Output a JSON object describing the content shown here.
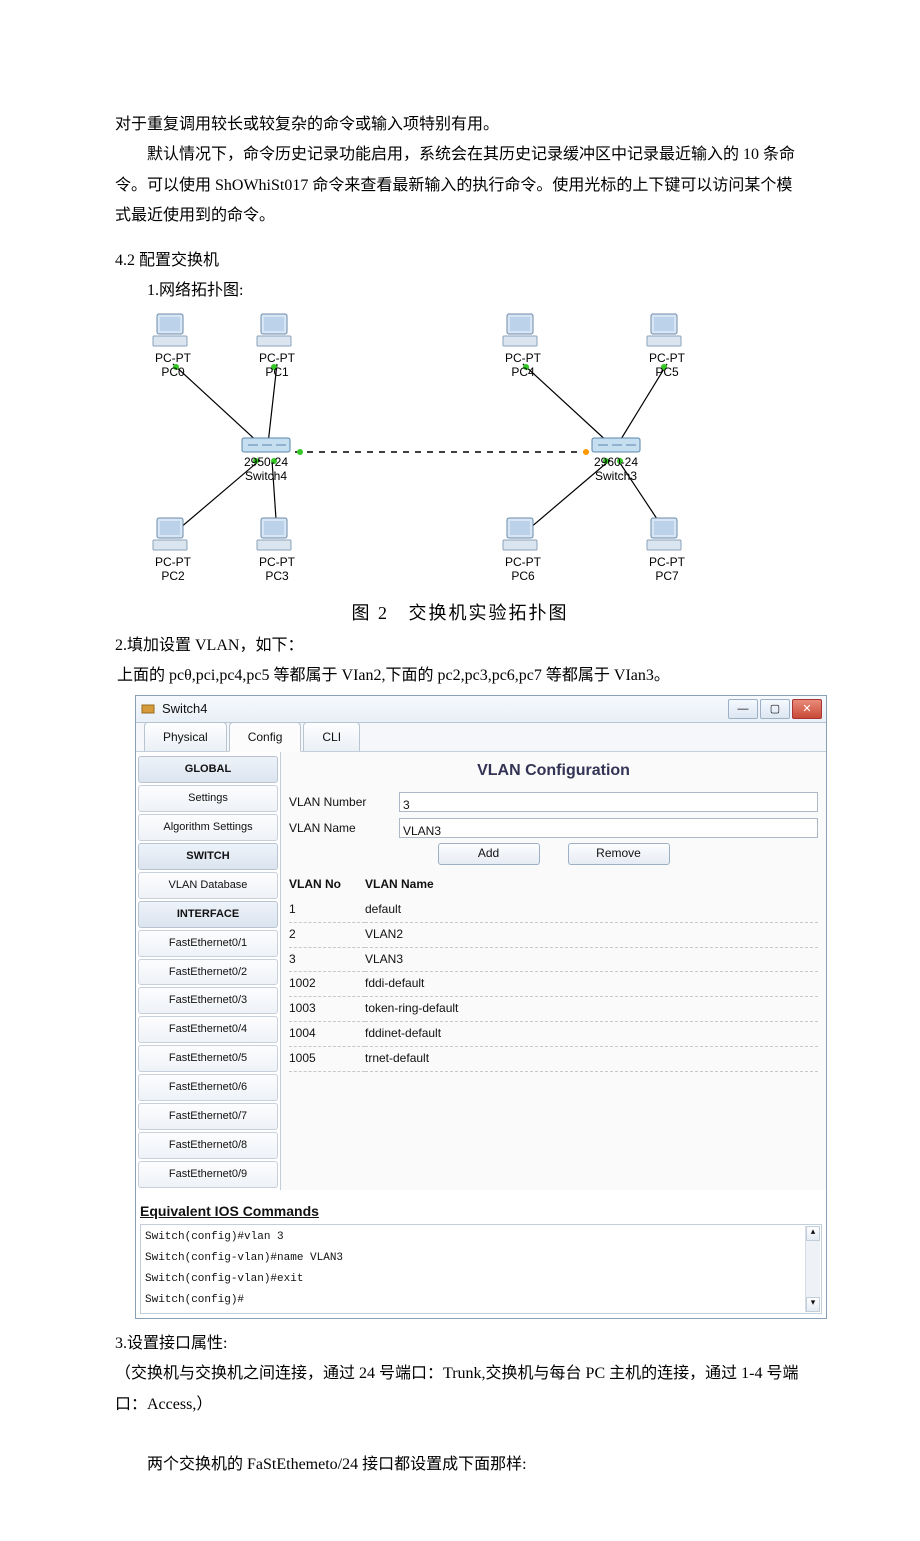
{
  "intro": {
    "p1": "对于重复调用较长或较复杂的命令或输入项特别有用。",
    "p2": "默认情况下，命令历史记录功能启用，系统会在其历史记录缓冲区中记录最近输入的 10 条命令。可以使用 ShOWhiSt017 命令来查看最新输入的执行命令。使用光标的上下键可以访问某个模式最近使用到的命令。"
  },
  "sec42": {
    "title": "4.2    配置交换机",
    "item1": "1.网络拓扑图:"
  },
  "topology": {
    "caption_label": "图 2",
    "caption_text": "交换机实验拓扑图",
    "devices": {
      "pc0": {
        "type": "PC-PT",
        "name": "PC0"
      },
      "pc1": {
        "type": "PC-PT",
        "name": "PC1"
      },
      "pc2": {
        "type": "PC-PT",
        "name": "PC2"
      },
      "pc3": {
        "type": "PC-PT",
        "name": "PC3"
      },
      "pc4": {
        "type": "PC-PT",
        "name": "PC4"
      },
      "pc5": {
        "type": "PC-PT",
        "name": "PC5"
      },
      "pc6": {
        "type": "PC-PT",
        "name": "PC6"
      },
      "pc7": {
        "type": "PC-PT",
        "name": "PC7"
      },
      "sw_left": {
        "type": "2950-24",
        "name": "Switch4"
      },
      "sw_right": {
        "type": "2960-24",
        "name": "Switch3"
      }
    }
  },
  "item2": {
    "title": "2.填加设置 VLAN，如下：",
    "desc": "上面的 pcθ,pci,pc4,pc5 等都属于 VIan2,下面的 pc2,pc3,pc6,pc7 等都属于 VIan3。"
  },
  "window": {
    "title": "Switch4",
    "tabs": {
      "physical": "Physical",
      "config": "Config",
      "cli": "CLI"
    },
    "sidebar": {
      "global": "GLOBAL",
      "settings": "Settings",
      "algo": "Algorithm Settings",
      "switch": "SWITCH",
      "vlan_db": "VLAN Database",
      "interface": "INTERFACE",
      "ifs": [
        "FastEthernet0/1",
        "FastEthernet0/2",
        "FastEthernet0/3",
        "FastEthernet0/4",
        "FastEthernet0/5",
        "FastEthernet0/6",
        "FastEthernet0/7",
        "FastEthernet0/8",
        "FastEthernet0/9"
      ]
    },
    "conf": {
      "title": "VLAN Configuration",
      "num_label": "VLAN Number",
      "num_value": "3",
      "name_label": "VLAN Name",
      "name_value": "VLAN3",
      "add": "Add",
      "remove": "Remove",
      "table_headers": {
        "no": "VLAN No",
        "name": "VLAN Name"
      },
      "rows": [
        {
          "no": "1",
          "name": "default"
        },
        {
          "no": "2",
          "name": "VLAN2"
        },
        {
          "no": "3",
          "name": "VLAN3"
        },
        {
          "no": "1002",
          "name": "fddi-default"
        },
        {
          "no": "1003",
          "name": "token-ring-default"
        },
        {
          "no": "1004",
          "name": "fddinet-default"
        },
        {
          "no": "1005",
          "name": "trnet-default"
        }
      ]
    },
    "ios": {
      "title": "Equivalent IOS Commands",
      "lines": [
        "Switch(config)#vlan 3",
        "Switch(config-vlan)#name VLAN3",
        "Switch(config-vlan)#exit",
        "Switch(config)#"
      ]
    }
  },
  "item3": {
    "title": "3.设置接口属性:",
    "p1": "（交换机与交换机之间连接，通过 24 号端口：Trunk,交换机与每台 PC 主机的连接，通过 1-4 号端口：Access,）",
    "p2": "两个交换机的 FaStEthemeto/24 接口都设置成下面那样:"
  }
}
